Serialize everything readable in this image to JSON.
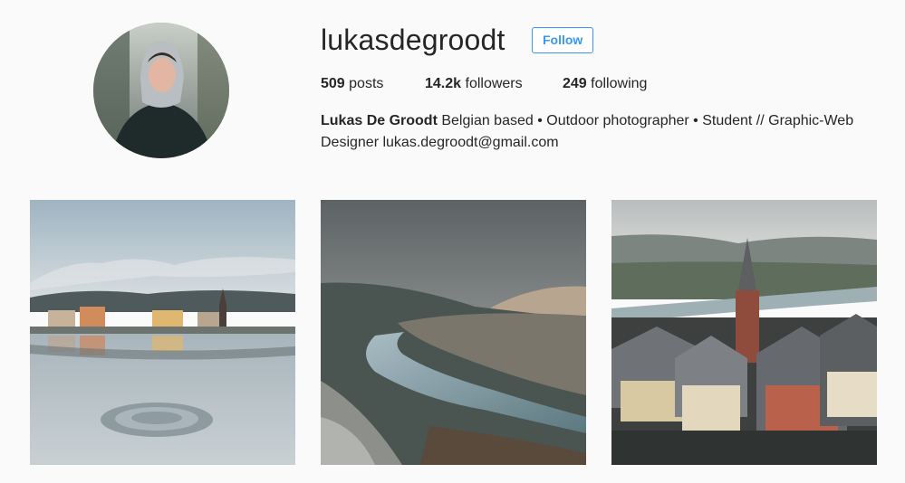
{
  "profile": {
    "username": "lukasdegroodt",
    "follow_label": "Follow",
    "avatar_icon": "profile-photo"
  },
  "stats": {
    "posts_count": "509",
    "posts_label": "posts",
    "followers_count": "14.2k",
    "followers_label": "followers",
    "following_count": "249",
    "following_label": "following"
  },
  "bio": {
    "full_name": "Lukas De Groodt",
    "text": "Belgian based • Outdoor photographer • Student // Graphic-Web Designer lukas.degroodt@gmail.com"
  },
  "posts": [
    {
      "icon": "lake-reflection-photo"
    },
    {
      "icon": "river-valley-photo"
    },
    {
      "icon": "town-church-photo"
    }
  ],
  "colors": {
    "accent": "#3897f0",
    "text": "#262626",
    "background": "#fafafa"
  }
}
